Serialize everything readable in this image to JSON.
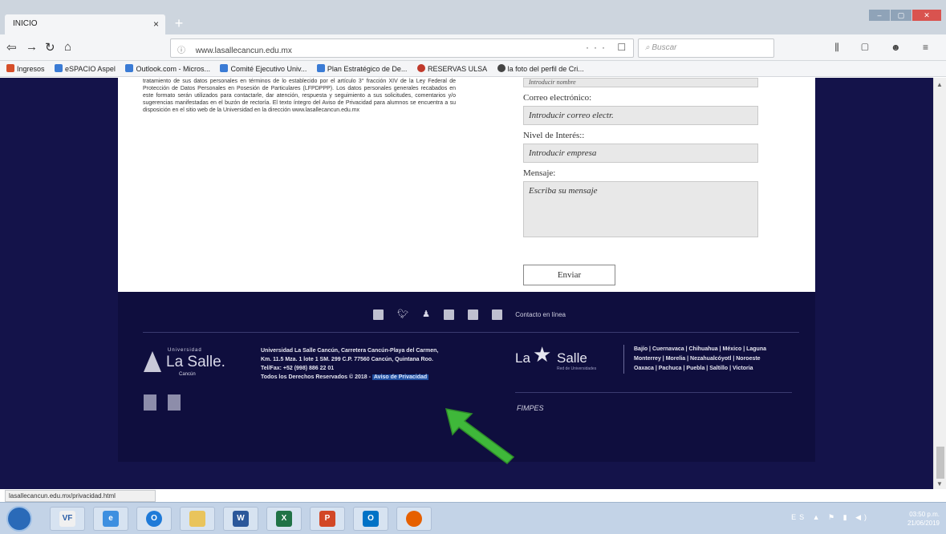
{
  "browser": {
    "tab_title": "INICIO",
    "tab_close": "×",
    "new_tab": "+",
    "url": "www.lasallecancun.edu.mx",
    "url_info_icon": "info-icon",
    "search_placeholder": "Buscar",
    "page_actions": "··· ☐ ☆"
  },
  "bookmarks": [
    "Ingresos",
    "eSPACIO Aspel",
    "Outlook.com - Micros...",
    "Comité Ejecutivo Univ...",
    "Plan Estratégico de De...",
    "RESERVAS ULSA",
    "la foto del perfil de Cri..."
  ],
  "page": {
    "privacy_text": "tratamiento de sus datos personales en términos de lo establecido por el artículo 3° fracción XIV de la Ley Federal de Protección de Datos Personales en Posesión de Particulares (LFPDPPP). Los datos personales generales recabados en este formato serán utilizados para contactarle, dar atención, respuesta y seguimiento a sus solicitudes, comentarios y/o sugerencias manifestadas en el buzón de rectoría. El texto íntegro del Aviso de Privacidad para alumnos se encuentra a su disposición en el sitio web de la Universidad en la dirección www.lasallecancun.edu.mx",
    "form": {
      "top_field_value": "Introducir nombre",
      "email_label": "Correo electrónico:",
      "email_placeholder": "Introducir correo electr.",
      "interest_label": "Nivel de Interés::",
      "interest_placeholder": "Introducir empresa",
      "message_label": "Mensaje:",
      "message_placeholder": "Escriba su mensaje",
      "send_label": "Enviar"
    }
  },
  "footer": {
    "social_contact": "Contacto en línea",
    "logo_universidad": "Universidad",
    "logo_name": "La Salle.",
    "logo_city": "Cancún",
    "address_line1": "Universidad La Salle Cancún, Carretera Cancún-Playa del Carmen,",
    "address_line2": "Km. 11.5 Mza. 1 lote 1 SM. 299 C.P. 77560 Cancún, Quintana Roo.",
    "address_line3": "Tel/Fax: +52 (998) 886 22 01",
    "rights": "Todos los Derechos Reservados © 2018 -",
    "privacy_link": "Aviso de Privacidad",
    "lasalle_la": "La",
    "lasalle_salle": "Salle",
    "lasalle_sub": "Red de Universidades",
    "cities_line1": "Bajío | Cuernavaca | Chihuahua | México | Laguna",
    "cities_line2": "Monterrey | Morelia | Nezahualcóyotl | Noroeste",
    "cities_line3": "Oaxaca | Pachuca | Puebla | Saltillo | Victoria",
    "fimpes": "FIMPES"
  },
  "status_url": "lasallecancun.edu.mx/privacidad.html",
  "taskbar": {
    "apps": [
      "VF",
      "e",
      "O",
      "",
      "W",
      "X",
      "P",
      "O",
      ""
    ],
    "tray_icons": "ES ▲ ⚑ ▮ ◀)",
    "time": "03:50 p.m.",
    "date": "21/06/2019"
  },
  "colors": {
    "footer_bg": "#0f0e3e",
    "page_bg": "#14134a",
    "arrow": "#3fb83a",
    "privacy_link_bg": "#1e4ea0"
  }
}
